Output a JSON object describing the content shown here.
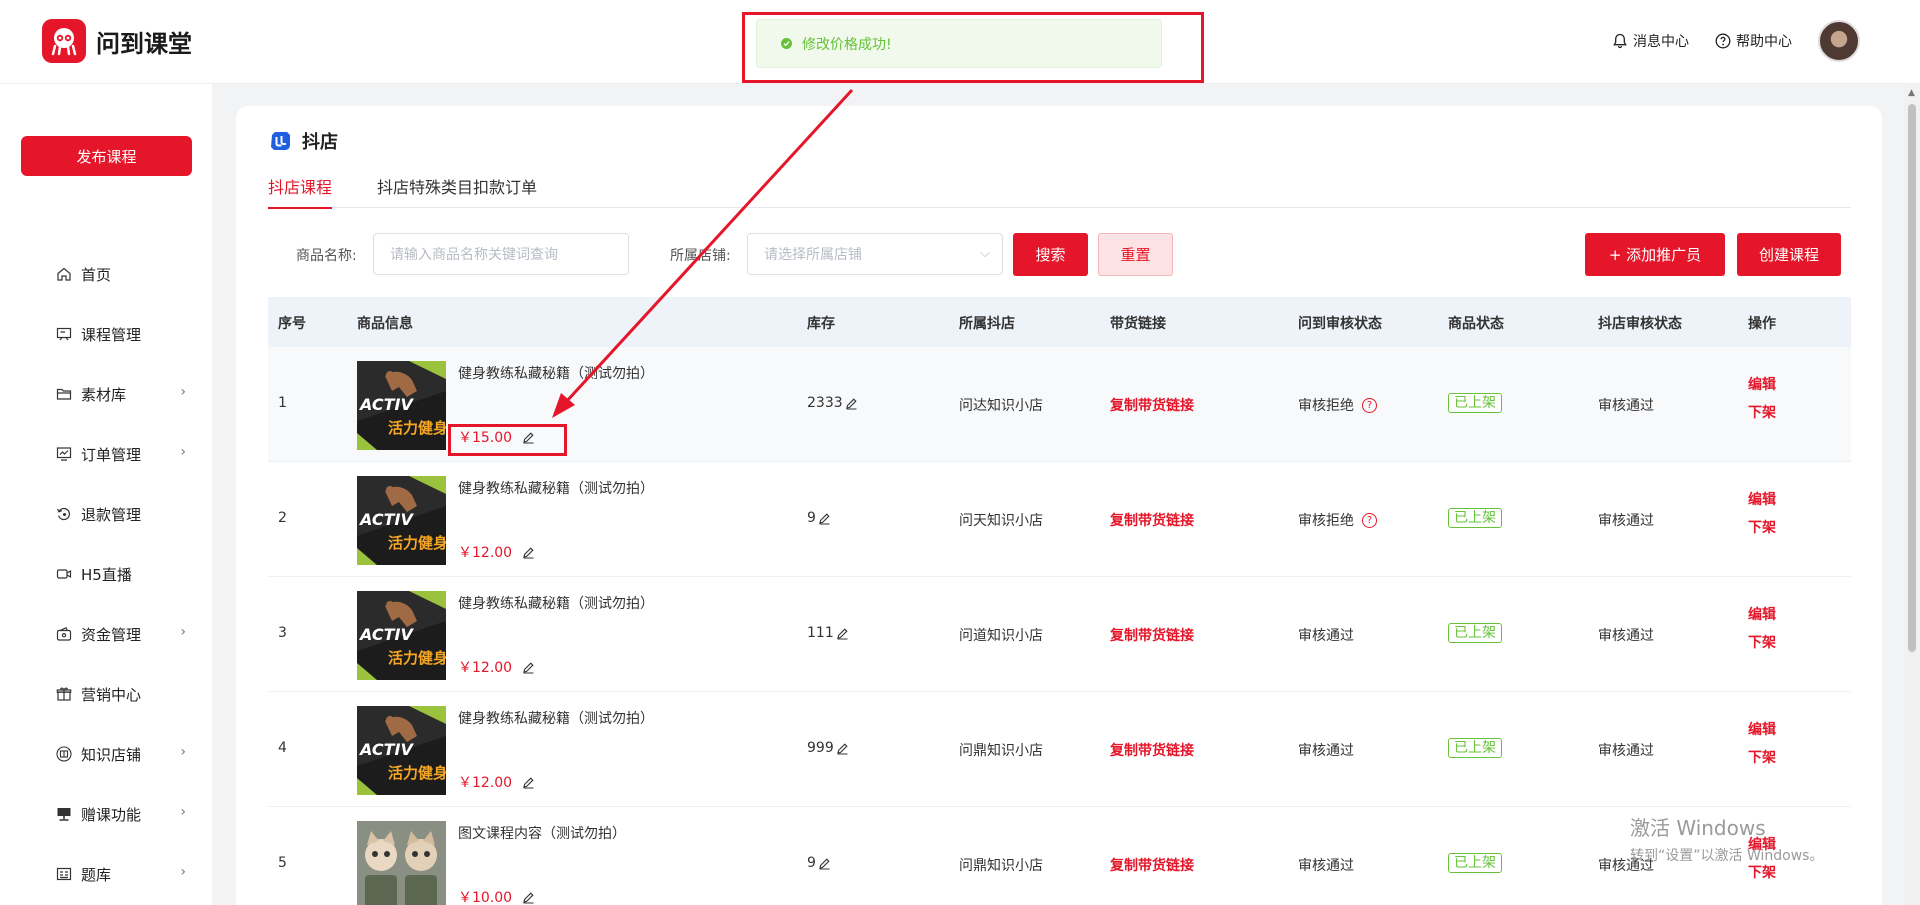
{
  "brand": {
    "name": "问到课堂",
    "color": "#e5162a"
  },
  "header": {
    "message_center": "消息中心",
    "help_center": "帮助中心"
  },
  "toast": {
    "text": "修改价格成功!"
  },
  "sidebar": {
    "publish_button": "发布课程",
    "items": [
      {
        "label": "首页",
        "icon": "home-icon",
        "has_arrow": false
      },
      {
        "label": "课程管理",
        "icon": "course-icon",
        "has_arrow": false
      },
      {
        "label": "素材库",
        "icon": "folder-icon",
        "has_arrow": true
      },
      {
        "label": "订单管理",
        "icon": "order-icon",
        "has_arrow": true
      },
      {
        "label": "退款管理",
        "icon": "refund-icon",
        "has_arrow": false
      },
      {
        "label": "H5直播",
        "icon": "live-icon",
        "has_arrow": false
      },
      {
        "label": "资金管理",
        "icon": "wallet-icon",
        "has_arrow": true
      },
      {
        "label": "营销中心",
        "icon": "gift-icon",
        "has_arrow": false
      },
      {
        "label": "知识店铺",
        "icon": "store-icon",
        "has_arrow": true
      },
      {
        "label": "赠课功能",
        "icon": "present-icon",
        "has_arrow": true
      },
      {
        "label": "题库",
        "icon": "question-bank-icon",
        "has_arrow": true
      }
    ]
  },
  "page": {
    "title": "抖店",
    "tabs": [
      {
        "label": "抖店课程",
        "active": true
      },
      {
        "label": "抖店特殊类目扣款订单",
        "active": false
      }
    ]
  },
  "filters": {
    "product_name_label": "商品名称:",
    "product_name_placeholder": "请输入商品名称关键词查询",
    "store_label": "所属店铺:",
    "store_placeholder": "请选择所属店铺",
    "search_button": "搜索",
    "reset_button": "重置",
    "add_promoter_button": "+ 添加推广员",
    "create_course_button": "创建课程"
  },
  "table": {
    "columns": [
      "序号",
      "商品信息",
      "库存",
      "所属抖店",
      "带货链接",
      "问到审核状态",
      "商品状态",
      "抖店审核状态",
      "操作"
    ],
    "rows": [
      {
        "index": "1",
        "name": "健身教练私藏秘籍（测试勿拍）",
        "price": "￥15.00",
        "stock": "2333",
        "store": "问达知识小店",
        "link": "复制带货链接",
        "wendao_audit": "审核拒绝",
        "audit_help": true,
        "status": "已上架",
        "douyin_audit": "审核通过",
        "op_edit": "编辑",
        "op_off": "下架",
        "thumb": "fitness"
      },
      {
        "index": "2",
        "name": "健身教练私藏秘籍（测试勿拍）",
        "price": "￥12.00",
        "stock": "9",
        "store": "问天知识小店",
        "link": "复制带货链接",
        "wendao_audit": "审核拒绝",
        "audit_help": true,
        "status": "已上架",
        "douyin_audit": "审核通过",
        "op_edit": "编辑",
        "op_off": "下架",
        "thumb": "fitness"
      },
      {
        "index": "3",
        "name": "健身教练私藏秘籍（测试勿拍）",
        "price": "￥12.00",
        "stock": "111",
        "store": "问道知识小店",
        "link": "复制带货链接",
        "wendao_audit": "审核通过",
        "audit_help": false,
        "status": "已上架",
        "douyin_audit": "审核通过",
        "op_edit": "编辑",
        "op_off": "下架",
        "thumb": "fitness"
      },
      {
        "index": "4",
        "name": "健身教练私藏秘籍（测试勿拍）",
        "price": "￥12.00",
        "stock": "999",
        "store": "问鼎知识小店",
        "link": "复制带货链接",
        "wendao_audit": "审核通过",
        "audit_help": false,
        "status": "已上架",
        "douyin_audit": "审核通过",
        "op_edit": "编辑",
        "op_off": "下架",
        "thumb": "fitness"
      },
      {
        "index": "5",
        "name": "图文课程内容（测试勿拍）",
        "price": "￥10.00",
        "stock": "9",
        "store": "问鼎知识小店",
        "link": "复制带货链接",
        "wendao_audit": "审核通过",
        "audit_help": false,
        "status": "已上架",
        "douyin_audit": "审核通过",
        "op_edit": "编辑",
        "op_off": "下架",
        "thumb": "cats"
      }
    ]
  },
  "thumb_text": {
    "activ": "ACTIV",
    "chinese": "活力健身"
  },
  "watermark": {
    "line1": "激活 Windows",
    "line2": "转到“设置”以激活 Windows。"
  }
}
